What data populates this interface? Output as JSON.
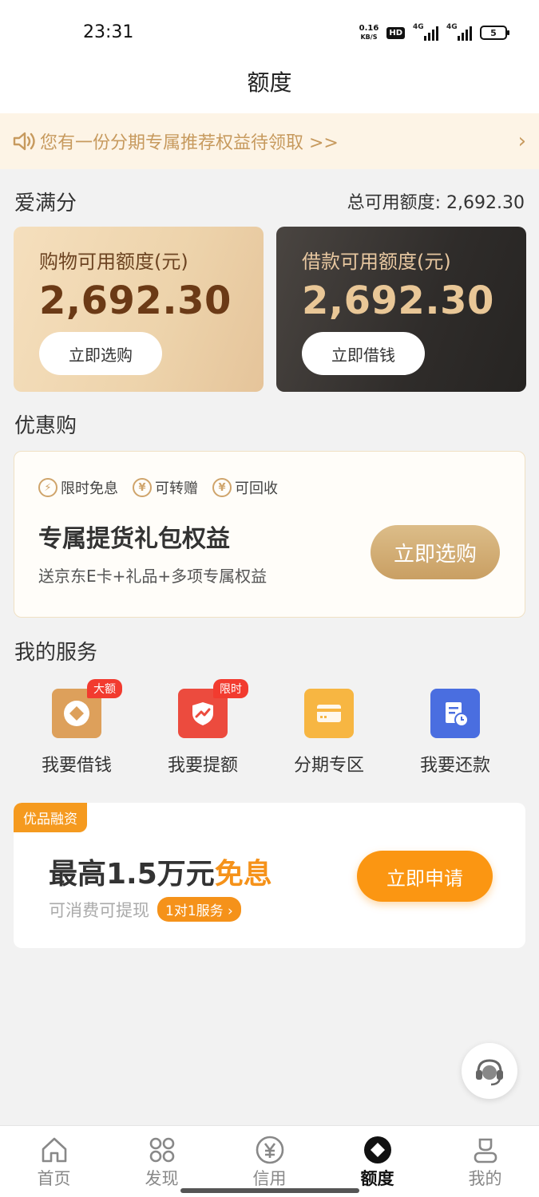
{
  "status_bar": {
    "time": "23:31",
    "net_speed_value": "0.16",
    "net_speed_unit": "KB/S",
    "hd_label": "HD",
    "signal1_label": "4G",
    "signal2_label": "4G",
    "battery": "5"
  },
  "header": {
    "title": "额度"
  },
  "notice": {
    "text": "您有一份分期专属推荐权益待领取 >>",
    "arrow": "›",
    "icon": "speaker-icon"
  },
  "score": {
    "title": "爱满分",
    "total_label": "总可用额度: 2,692.30"
  },
  "cards": {
    "shopping": {
      "label": "购物可用额度(元)",
      "amount": "2,692.30",
      "button": "立即选购"
    },
    "loan": {
      "label": "借款可用额度(元)",
      "amount": "2,692.30",
      "button": "立即借钱"
    }
  },
  "promo": {
    "section_title": "优惠购",
    "tags": [
      {
        "icon": "lightning-icon",
        "label": "限时免息"
      },
      {
        "icon": "yen-icon",
        "label": "可转赠"
      },
      {
        "icon": "yen-icon",
        "label": "可回收"
      }
    ],
    "title": "专属提货礼包权益",
    "subtitle": "送京东E卡+礼品+多项专属权益",
    "button": "立即选购"
  },
  "services": {
    "title": "我的服务",
    "items": [
      {
        "name": "我要借钱",
        "badge": "大额",
        "icon": "diamond-icon",
        "color": "#dda05b"
      },
      {
        "name": "我要提额",
        "badge": "限时",
        "icon": "shield-chart-icon",
        "color": "#ec4b3e"
      },
      {
        "name": "分期专区",
        "badge": "",
        "icon": "card-icon",
        "color": "#f7b642"
      },
      {
        "name": "我要还款",
        "badge": "",
        "icon": "bill-clock-icon",
        "color": "#4a6ee0"
      }
    ]
  },
  "finance": {
    "tag": "优品融资",
    "title_main": "最高1.5万元",
    "title_highlight": "免息",
    "subtitle": "可消费可提现",
    "chip": "1对1服务 ›",
    "button": "立即申请"
  },
  "tabbar": {
    "items": [
      {
        "label": "首页",
        "icon": "home-icon",
        "active": false
      },
      {
        "label": "发现",
        "icon": "grid-icon",
        "active": false
      },
      {
        "label": "信用",
        "icon": "yen-circle-icon",
        "active": false
      },
      {
        "label": "额度",
        "icon": "diamond-badge-icon",
        "active": true
      },
      {
        "label": "我的",
        "icon": "user-icon",
        "active": false
      }
    ]
  },
  "colors": {
    "accent_gold": "#c99f63",
    "accent_orange": "#fb9612",
    "notice_bg": "#fdf4e6"
  }
}
